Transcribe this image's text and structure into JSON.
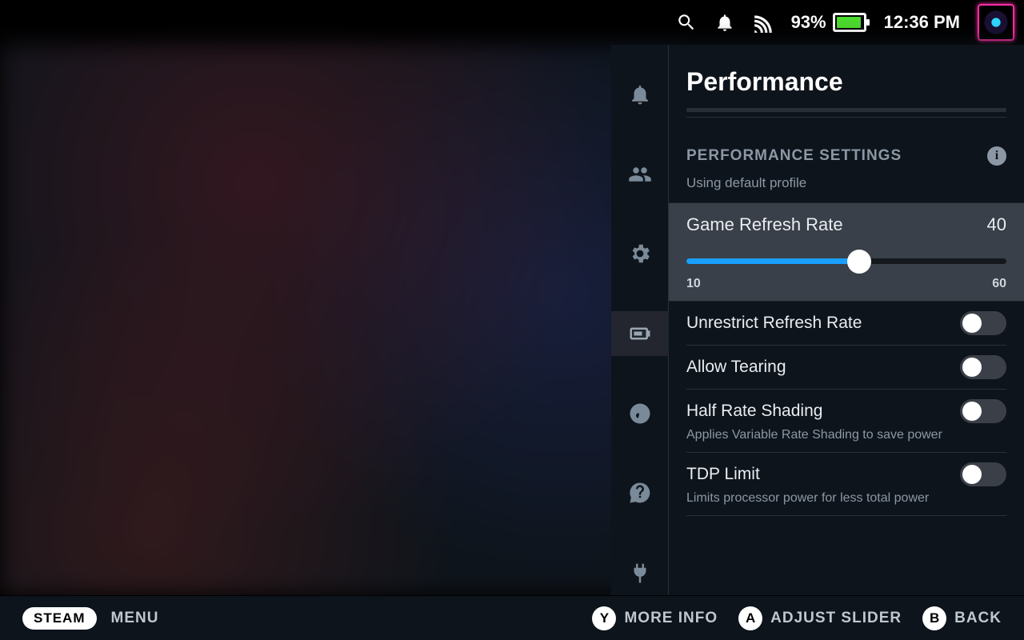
{
  "status": {
    "battery_pct": "93%",
    "time": "12:36 PM"
  },
  "panel": {
    "title": "Performance",
    "section_heading": "PERFORMANCE SETTINGS",
    "profile_note": "Using default profile",
    "slider": {
      "label": "Game Refresh Rate",
      "value": "40",
      "min": "10",
      "max": "60",
      "fill_pct": 54
    },
    "toggles": [
      {
        "label": "Unrestrict Refresh Rate",
        "desc": "",
        "on": false
      },
      {
        "label": "Allow Tearing",
        "desc": "",
        "on": false
      },
      {
        "label": "Half Rate Shading",
        "desc": "Applies Variable Rate Shading to save power",
        "on": false
      },
      {
        "label": "TDP Limit",
        "desc": "Limits processor power for less total power",
        "on": false
      }
    ]
  },
  "footer": {
    "steam": "STEAM",
    "menu": "MENU",
    "actions": [
      {
        "glyph": "Y",
        "label": "MORE INFO"
      },
      {
        "glyph": "A",
        "label": "ADJUST SLIDER"
      },
      {
        "glyph": "B",
        "label": "BACK"
      }
    ]
  }
}
